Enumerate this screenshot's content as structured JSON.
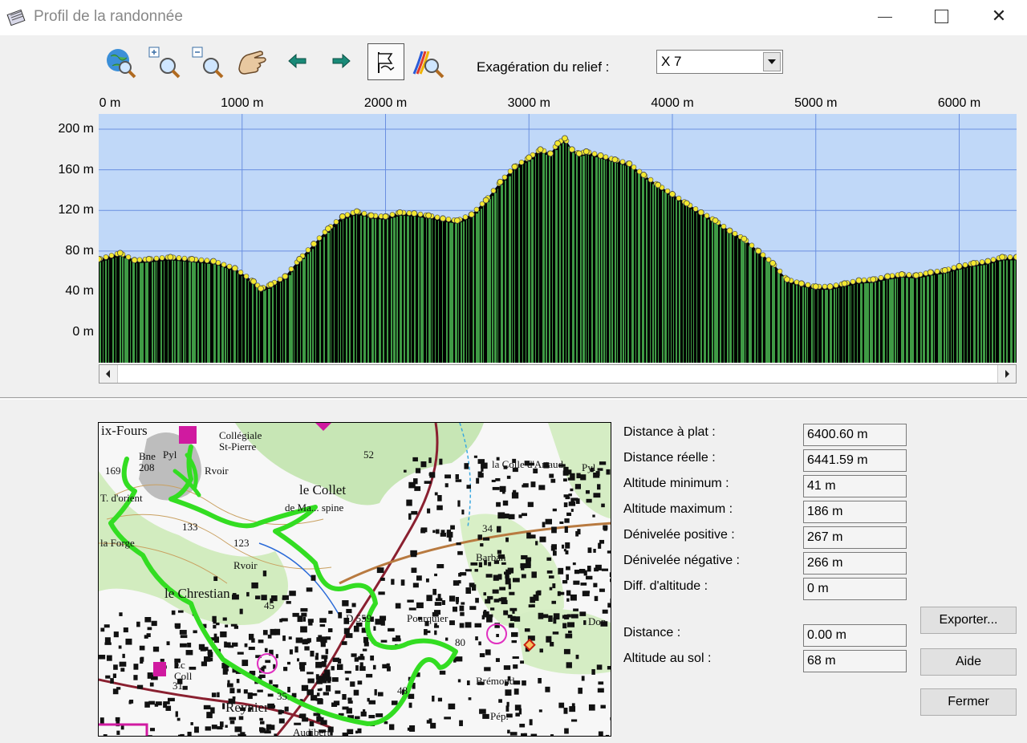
{
  "window": {
    "title": "Profil de la randonnée",
    "minimize_label": "",
    "close_label": "✕"
  },
  "toolbar": {
    "items": [
      {
        "icon": "globe-search-icon"
      },
      {
        "icon": "zoom-in-icon"
      },
      {
        "icon": "zoom-out-icon"
      },
      {
        "icon": "hand-pan-icon"
      },
      {
        "icon": "arrow-left-icon"
      },
      {
        "icon": "arrow-right-icon"
      },
      {
        "icon": "flag-icon",
        "active": true
      },
      {
        "icon": "profile-zoom-icon"
      }
    ],
    "relief_label": "Exagération du relief :",
    "relief_value": "X 7"
  },
  "chart_data": {
    "type": "area",
    "x_unit": "m",
    "y_unit": "m",
    "x_ticks": [
      "0 m",
      "1000 m",
      "2000 m",
      "3000 m",
      "4000 m",
      "5000 m",
      "6000 m"
    ],
    "y_ticks": [
      "200 m",
      "160 m",
      "120 m",
      "80 m",
      "40 m",
      "0 m"
    ],
    "xlim": [
      0,
      6400
    ],
    "ylim": [
      -30,
      215
    ],
    "grid": true,
    "series": [
      {
        "x": [
          0,
          150,
          250,
          350,
          500,
          650,
          800,
          950,
          1080,
          1130,
          1200,
          1300,
          1400,
          1500,
          1600,
          1700,
          1800,
          1900,
          2000,
          2100,
          2200,
          2300,
          2400,
          2500,
          2600,
          2700,
          2800,
          2900,
          3000,
          3080,
          3150,
          3200,
          3250,
          3300,
          3350,
          3400,
          3500,
          3600,
          3700,
          3800,
          3900,
          4000,
          4100,
          4200,
          4300,
          4400,
          4500,
          4600,
          4700,
          4800,
          4900,
          5000,
          5100,
          5200,
          5300,
          5400,
          5500,
          5600,
          5700,
          5800,
          5900,
          6000,
          6100,
          6200,
          6300,
          6400
        ],
        "y": [
          72,
          78,
          71,
          72,
          74,
          72,
          70,
          63,
          50,
          43,
          47,
          55,
          72,
          87,
          102,
          114,
          119,
          115,
          114,
          118,
          117,
          115,
          112,
          110,
          116,
          130,
          148,
          163,
          172,
          180,
          176,
          186,
          191,
          180,
          176,
          178,
          174,
          170,
          166,
          155,
          145,
          136,
          127,
          118,
          110,
          100,
          92,
          80,
          68,
          52,
          48,
          45,
          45,
          48,
          51,
          52,
          55,
          57,
          56,
          59,
          61,
          65,
          68,
          70,
          74,
          74
        ]
      }
    ],
    "fill_color": "#3f9a45",
    "sky_color": "#c0d8f8",
    "point_color": "#f3e830"
  },
  "map": {
    "labels": [
      "ix-Fours",
      "Collégiale",
      "St-Pierre",
      "Bne",
      "208",
      "Pyl",
      "Rvoir",
      "le Collet",
      "de Ma... spine",
      "T. d'orient",
      "169",
      "133",
      "la Forge",
      "123",
      "Rvoir",
      "le Chrestian",
      "45",
      "Pourquier",
      "Brémond",
      "Barban",
      "la Colle d'Artaud",
      "Pyl",
      "Reynier",
      "Audibert",
      "Pép.",
      "Coll",
      "Éc",
      "31",
      "35",
      "48",
      "80",
      "52",
      "34",
      "D 559",
      "Don"
    ],
    "route_color": "#33dd22"
  },
  "stats": [
    {
      "label": "Distance à plat :",
      "value": "6400.60 m"
    },
    {
      "label": "Distance réelle :",
      "value": "6441.59 m"
    },
    {
      "label": "Altitude minimum :",
      "value": "41 m"
    },
    {
      "label": "Altitude maximum :",
      "value": "186 m"
    },
    {
      "label": "Dénivelée positive :",
      "value": "267 m"
    },
    {
      "label": "Dénivelée négative :",
      "value": "266 m"
    },
    {
      "label": "Diff. d'altitude :",
      "value": "0 m"
    },
    {
      "label": "Distance :",
      "value": "0.00 m"
    },
    {
      "label": "Altitude au sol :",
      "value": "68 m"
    }
  ],
  "buttons": {
    "export": "Exporter...",
    "help": "Aide",
    "close": "Fermer"
  }
}
